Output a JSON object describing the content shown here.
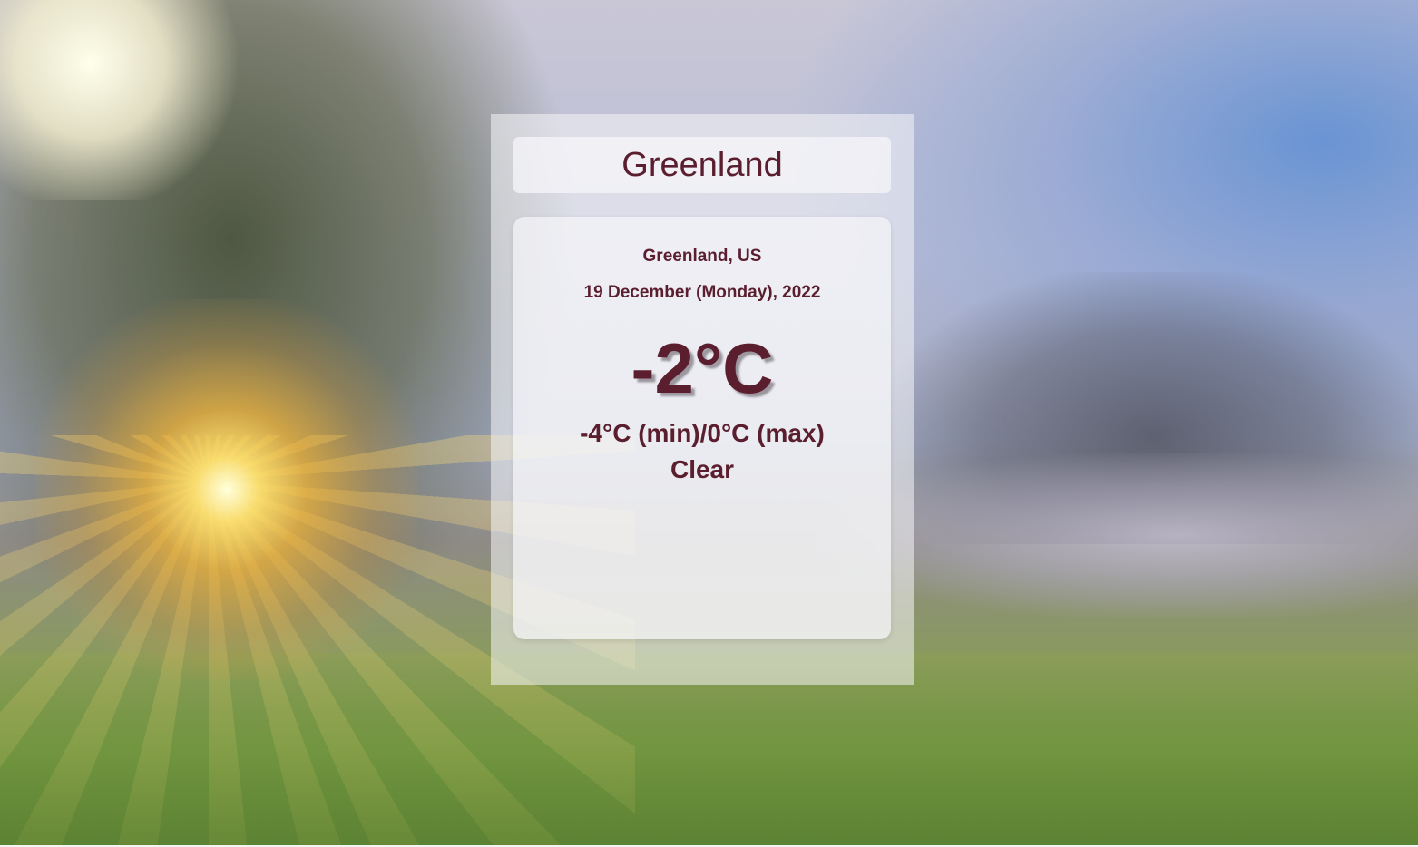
{
  "search": {
    "value": "Greenland"
  },
  "weather": {
    "location": "Greenland, US",
    "date": "19 December (Monday), 2022",
    "temperature": "-2°C",
    "min_max": "-4°C (min)/0°C (max)",
    "condition": "Clear"
  },
  "colors": {
    "text": "#5a1e2e"
  }
}
